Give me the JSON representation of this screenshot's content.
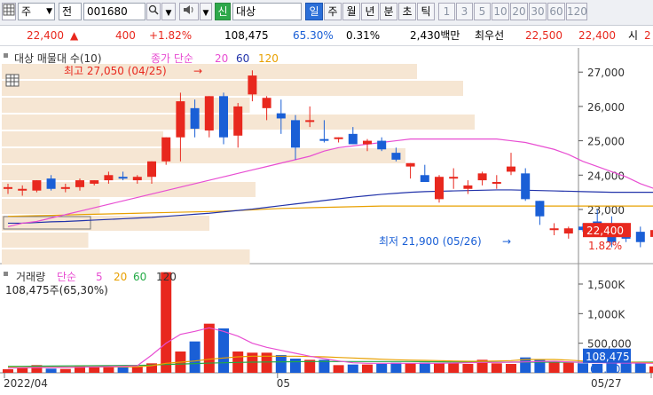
{
  "toolbar": {
    "market": "주",
    "scope": "전",
    "code": "001680",
    "search_icon": "search-icon",
    "stock_name": "대상",
    "credit_badge": "신",
    "periods": [
      "일",
      "주",
      "월",
      "년",
      "분",
      "초",
      "틱"
    ],
    "active_period": "일",
    "intervals": [
      "1",
      "3",
      "5",
      "10",
      "20",
      "30",
      "60",
      "120"
    ]
  },
  "price_line": {
    "price": "22,400",
    "change_arrow": "▲",
    "change": "400",
    "change_pct": "+1.82%",
    "volume": "108,475",
    "volume_ratio": "65.30%",
    "turnover": "0.31%",
    "amount": "2,430백만",
    "best_ask_label": "최우선",
    "best_ask": "22,500",
    "best_bid": "22,400",
    "next_label": "시",
    "next_value": "2"
  },
  "colors": {
    "up": "#e8281e",
    "down": "#1a5fd6",
    "ma5": "#444444",
    "ma20": "#e84ed2",
    "ma60": "#2233aa",
    "ma120": "#e8a000",
    "volume_profile": "#f6e6d3"
  },
  "chart_data": {
    "type": "candlestick",
    "title": "대상 매물대 수(10)",
    "legend": [
      {
        "label": "종가 단순",
        "color": "#e84ed2"
      },
      {
        "label": "20",
        "color": "#e84ed2"
      },
      {
        "label": "60",
        "color": "#2233aa"
      },
      {
        "label": "120",
        "color": "#e8a000"
      }
    ],
    "y_ticks": [
      "27,000",
      "26,000",
      "25,000",
      "24,000",
      "23,000"
    ],
    "ylim": [
      21500,
      27600
    ],
    "candles": [
      {
        "o": 23650,
        "h": 23750,
        "l": 23450,
        "c": 23650
      },
      {
        "o": 23550,
        "h": 23700,
        "l": 23400,
        "c": 23600
      },
      {
        "o": 23550,
        "h": 23850,
        "l": 23500,
        "c": 23850
      },
      {
        "o": 23900,
        "h": 24000,
        "l": 23550,
        "c": 23600
      },
      {
        "o": 23600,
        "h": 23750,
        "l": 23500,
        "c": 23650
      },
      {
        "o": 23650,
        "h": 23900,
        "l": 23550,
        "c": 23850
      },
      {
        "o": 23750,
        "h": 23850,
        "l": 23700,
        "c": 23850
      },
      {
        "o": 23850,
        "h": 24100,
        "l": 23750,
        "c": 24000
      },
      {
        "o": 23950,
        "h": 24100,
        "l": 23850,
        "c": 23900
      },
      {
        "o": 23850,
        "h": 24000,
        "l": 23750,
        "c": 23950
      },
      {
        "o": 23950,
        "h": 24400,
        "l": 23750,
        "c": 24400
      },
      {
        "o": 24400,
        "h": 25100,
        "l": 24300,
        "c": 25100
      },
      {
        "o": 25100,
        "h": 26400,
        "l": 24400,
        "c": 26150
      },
      {
        "o": 25950,
        "h": 26200,
        "l": 25100,
        "c": 25350
      },
      {
        "o": 25300,
        "h": 26300,
        "l": 25100,
        "c": 26300
      },
      {
        "o": 26300,
        "h": 26400,
        "l": 24900,
        "c": 25100
      },
      {
        "o": 25150,
        "h": 26100,
        "l": 24800,
        "c": 26000
      },
      {
        "o": 26350,
        "h": 27050,
        "l": 26150,
        "c": 26900
      },
      {
        "o": 25950,
        "h": 26300,
        "l": 25600,
        "c": 26250
      },
      {
        "o": 25800,
        "h": 26200,
        "l": 25200,
        "c": 25650
      },
      {
        "o": 25600,
        "h": 25750,
        "l": 24450,
        "c": 24800
      },
      {
        "o": 25550,
        "h": 26000,
        "l": 25400,
        "c": 25600
      },
      {
        "o": 25050,
        "h": 25600,
        "l": 24950,
        "c": 25000
      },
      {
        "o": 25050,
        "h": 25100,
        "l": 24950,
        "c": 25100
      },
      {
        "o": 25200,
        "h": 25400,
        "l": 24900,
        "c": 24900
      },
      {
        "o": 24900,
        "h": 25050,
        "l": 24700,
        "c": 25000
      },
      {
        "o": 25000,
        "h": 25100,
        "l": 24700,
        "c": 24750
      },
      {
        "o": 24650,
        "h": 24800,
        "l": 24400,
        "c": 24450
      },
      {
        "o": 24250,
        "h": 24350,
        "l": 23900,
        "c": 24350
      },
      {
        "o": 24000,
        "h": 24300,
        "l": 23800,
        "c": 23800
      },
      {
        "o": 23300,
        "h": 24000,
        "l": 23200,
        "c": 23950
      },
      {
        "o": 23950,
        "h": 24200,
        "l": 23600,
        "c": 23950
      },
      {
        "o": 23600,
        "h": 23850,
        "l": 23450,
        "c": 23700
      },
      {
        "o": 23850,
        "h": 24100,
        "l": 23700,
        "c": 24050
      },
      {
        "o": 23750,
        "h": 24000,
        "l": 23600,
        "c": 23800
      },
      {
        "o": 24100,
        "h": 24650,
        "l": 24000,
        "c": 24250
      },
      {
        "o": 24050,
        "h": 24200,
        "l": 23250,
        "c": 23300
      },
      {
        "o": 23250,
        "h": 23250,
        "l": 22550,
        "c": 22800
      },
      {
        "o": 22450,
        "h": 22600,
        "l": 22250,
        "c": 22450
      },
      {
        "o": 22300,
        "h": 22500,
        "l": 22150,
        "c": 22450
      },
      {
        "o": 22500,
        "h": 22600,
        "l": 22350,
        "c": 22400
      },
      {
        "o": 22650,
        "h": 23000,
        "l": 22300,
        "c": 22350
      },
      {
        "o": 22350,
        "h": 22800,
        "l": 21900,
        "c": 22050
      },
      {
        "o": 22200,
        "h": 22350,
        "l": 22050,
        "c": 22150
      },
      {
        "o": 22350,
        "h": 22500,
        "l": 21900,
        "c": 22050
      },
      {
        "o": 22200,
        "h": 22600,
        "l": 22050,
        "c": 22400
      }
    ],
    "ma20": [
      22500,
      22600,
      22650,
      22750,
      22850,
      22950,
      23050,
      23150,
      23250,
      23350,
      23450,
      23550,
      23650,
      23750,
      23850,
      23950,
      24050,
      24150,
      24250,
      24350,
      24450,
      24550,
      24700,
      24800,
      24850,
      24900,
      24950,
      25000,
      25050,
      25050,
      25050,
      25050,
      25050,
      25050,
      25050,
      25000,
      24950,
      24850,
      24750,
      24600,
      24400,
      24250,
      24100,
      23950,
      23750,
      23600
    ],
    "ma60": [
      22600,
      22600,
      22620,
      22640,
      22650,
      22670,
      22690,
      22710,
      22730,
      22750,
      22770,
      22800,
      22830,
      22860,
      22890,
      22930,
      22970,
      23010,
      23060,
      23110,
      23160,
      23210,
      23260,
      23310,
      23360,
      23400,
      23440,
      23470,
      23500,
      23520,
      23530,
      23540,
      23550,
      23560,
      23570,
      23570,
      23560,
      23550,
      23540,
      23530,
      23520,
      23510,
      23500,
      23500,
      23500,
      23500
    ],
    "ma120": [
      22800,
      22810,
      22820,
      22830,
      22840,
      22850,
      22860,
      22870,
      22880,
      22890,
      22900,
      22910,
      22920,
      22930,
      22940,
      22950,
      22970,
      22990,
      23010,
      23030,
      23040,
      23050,
      23060,
      23070,
      23080,
      23090,
      23100,
      23100,
      23100,
      23100,
      23100,
      23100,
      23100,
      23100,
      23100,
      23100,
      23100,
      23100,
      23100,
      23100,
      23100,
      23100,
      23100,
      23100,
      23100,
      23100
    ],
    "annotations": {
      "high": "최고 27,050 (04/25)",
      "low": "최저 21,900 (05/26)"
    },
    "current_price_label": "22,400",
    "current_change_label": "1.82%",
    "volume_profile": [
      0.72,
      0.8,
      0.43,
      0.82,
      0.28,
      0.7,
      0.26,
      0.44,
      0.17,
      0.36,
      0.15,
      0.43
    ],
    "volume_profile_label": "대상 매물대 수(10)",
    "volume_panel": {
      "legend": [
        {
          "label": "거래량",
          "color": "#333333"
        },
        {
          "label": "단순",
          "color": "#e84ed2"
        },
        {
          "label": "5",
          "color": "#e84ed2"
        },
        {
          "label": "20",
          "color": "#e8a000"
        },
        {
          "label": "60",
          "color": "#22aa44"
        },
        {
          "label": "120",
          "color": "#333333"
        }
      ],
      "current_label": "108,475주(65,30%)",
      "y_ticks": [
        "1,500K",
        "1,000K",
        "500,000"
      ],
      "ylim": [
        0,
        1800000
      ],
      "current_value_label": "108,475",
      "current_ratio_label": "65.30%",
      "volumes": [
        60000,
        90000,
        130000,
        70000,
        65000,
        110000,
        90000,
        100000,
        90000,
        110000,
        160000,
        1700000,
        360000,
        530000,
        830000,
        750000,
        360000,
        340000,
        340000,
        300000,
        240000,
        220000,
        220000,
        130000,
        140000,
        140000,
        150000,
        170000,
        160000,
        170000,
        160000,
        160000,
        150000,
        220000,
        160000,
        150000,
        260000,
        220000,
        180000,
        170000,
        160000,
        150000,
        180000,
        160000,
        180000,
        108475
      ],
      "ma5": [
        80000,
        85000,
        88000,
        90000,
        92000,
        95000,
        100000,
        105000,
        110000,
        120000,
        300000,
        500000,
        650000,
        700000,
        760000,
        700000,
        620000,
        500000,
        430000,
        380000,
        330000,
        280000,
        240000,
        200000,
        170000,
        160000,
        160000,
        160000,
        160000,
        160000,
        160000,
        165000,
        170000,
        175000,
        175000,
        180000,
        185000,
        190000,
        195000,
        185000,
        175000,
        170000,
        168000,
        165000,
        165000,
        160000
      ],
      "ma20": [
        90000,
        90000,
        92000,
        94000,
        96000,
        98000,
        100000,
        100000,
        100000,
        100000,
        120000,
        160000,
        180000,
        200000,
        230000,
        250000,
        270000,
        280000,
        280000,
        280000,
        280000,
        275000,
        270000,
        260000,
        250000,
        240000,
        230000,
        220000,
        215000,
        210000,
        205000,
        200000,
        195000,
        195000,
        200000,
        205000,
        225000,
        225000,
        225000,
        215000,
        200000,
        190000,
        185000,
        180000,
        175000,
        170000
      ],
      "ma60": [
        110000,
        110000,
        112000,
        114000,
        116000,
        118000,
        120000,
        122000,
        124000,
        126000,
        130000,
        140000,
        148000,
        156000,
        164000,
        170000,
        175000,
        180000,
        183000,
        186000,
        188000,
        190000,
        190000,
        190000,
        190000,
        190000,
        190000,
        190000,
        190000,
        188000,
        186000,
        184000,
        182000,
        180000,
        180000,
        180000,
        180000,
        180000,
        180000,
        180000,
        180000,
        180000,
        180000,
        180000,
        180000,
        180000
      ]
    },
    "x_labels": [
      {
        "label": "2022/04",
        "index": 0
      },
      {
        "label": "05",
        "index": 19
      },
      {
        "label": "05/27",
        "index": 45
      }
    ]
  }
}
